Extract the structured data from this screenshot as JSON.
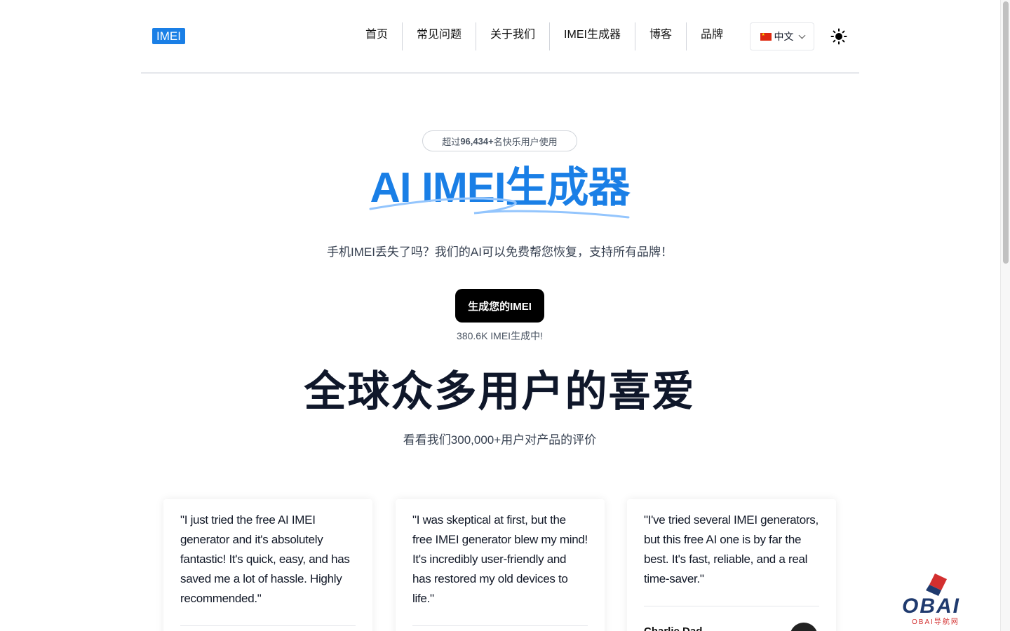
{
  "header": {
    "logo": "IMEI",
    "nav": [
      "首页",
      "常见问题",
      "关于我们",
      "IMEI生成器",
      "博客",
      "品牌"
    ],
    "language": "中文"
  },
  "hero": {
    "badge_prefix": "超过",
    "badge_count": "96,434+",
    "badge_suffix": "名快乐用户使用",
    "title": "AI IMEI生成器",
    "subtitle": "手机IMEI丢失了吗？我们的AI可以免费帮您恢复，支持所有品牌！",
    "cta": "生成您的IMEI",
    "cta_note": "380.6K IMEI生成中!"
  },
  "testimonials_section": {
    "title": "全球众多用户的喜爱",
    "subtitle": "看看我们300,000+用户对产品的评价"
  },
  "testimonials": [
    {
      "quote": "\"I just tried the free AI IMEI generator and it's absolutely fantastic! It's quick, easy, and has saved me a lot of hassle. Highly recommended.\""
    },
    {
      "quote": "\"I was skeptical at first, but the free IMEI generator blew my mind! It's incredibly user-friendly and has restored my old devices to life.\""
    },
    {
      "quote": "\"I've tried several IMEI generators, but this free AI one is by far the best. It's fast, reliable, and a real time-saver.\"",
      "author": "Charlie Dad..."
    }
  ],
  "watermark": {
    "brand": "OBAI",
    "tagline": "OBAI导航网"
  },
  "colors": {
    "accent": "#1a7fe6",
    "cta_bg": "#000000",
    "heading": "#0f172a"
  }
}
